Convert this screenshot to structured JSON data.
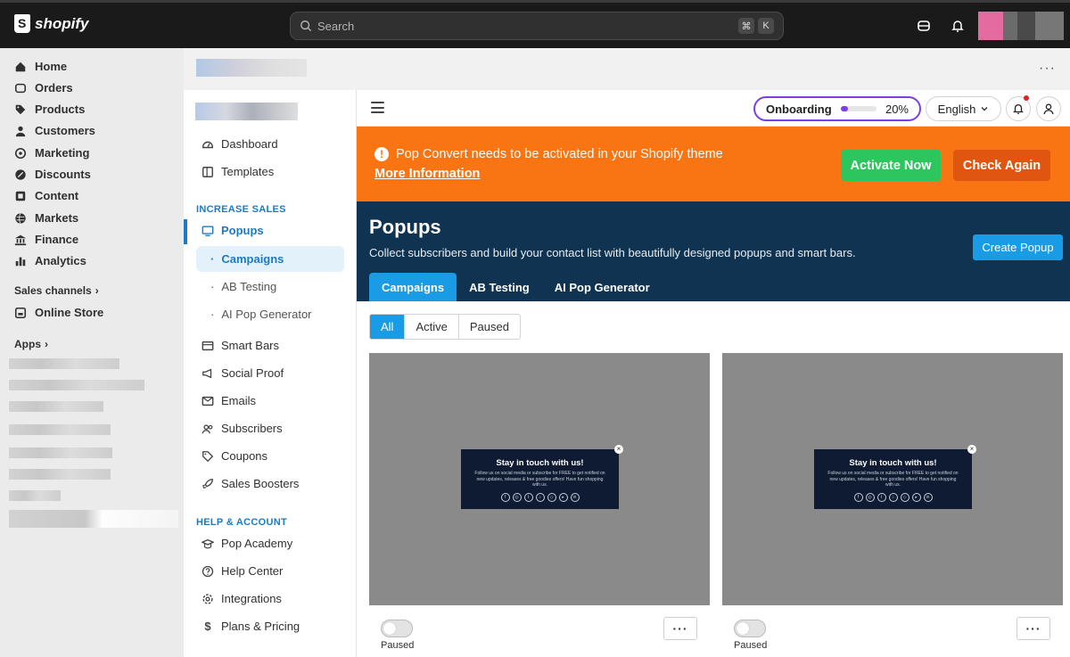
{
  "topbar": {
    "brand": "shopify",
    "search_placeholder": "Search",
    "shortcut": [
      "⌘",
      "K"
    ]
  },
  "sidebar": {
    "items": [
      {
        "label": "Home",
        "icon": "home-icon"
      },
      {
        "label": "Orders",
        "icon": "orders-icon"
      },
      {
        "label": "Products",
        "icon": "tag-icon"
      },
      {
        "label": "Customers",
        "icon": "person-icon"
      },
      {
        "label": "Marketing",
        "icon": "target-icon"
      },
      {
        "label": "Discounts",
        "icon": "discount-icon"
      },
      {
        "label": "Content",
        "icon": "content-icon"
      },
      {
        "label": "Markets",
        "icon": "globe-icon"
      },
      {
        "label": "Finance",
        "icon": "bank-icon"
      },
      {
        "label": "Analytics",
        "icon": "chart-icon"
      }
    ],
    "sales_channels_label": "Sales channels",
    "online_store": "Online Store",
    "apps_label": "Apps"
  },
  "app_nav": {
    "dashboard": "Dashboard",
    "templates": "Templates",
    "increase_sales": "INCREASE SALES",
    "popups": "Popups",
    "campaigns": "Campaigns",
    "ab_testing": "AB Testing",
    "ai_pop_generator": "AI Pop Generator",
    "smart_bars": "Smart Bars",
    "social_proof": "Social Proof",
    "emails": "Emails",
    "subscribers": "Subscribers",
    "coupons": "Coupons",
    "sales_boosters": "Sales Boosters",
    "help_account": "HELP & ACCOUNT",
    "pop_academy": "Pop Academy",
    "help_center": "Help Center",
    "integrations": "Integrations",
    "plans_pricing": "Plans & Pricing"
  },
  "app_header": {
    "onboarding_label": "Onboarding",
    "onboarding_progress": 0.2,
    "onboarding_pct": "20%",
    "language": "English"
  },
  "alert": {
    "message": "Pop Convert needs to be activated in your Shopify theme",
    "link": "More Information",
    "activate_label": "Activate Now",
    "check_label": "Check Again"
  },
  "hero": {
    "title": "Popups",
    "description": "Collect subscribers and build your contact list with beautifully designed popups and smart bars.",
    "create_label": "Create Popup",
    "tabs": [
      "Campaigns",
      "AB Testing",
      "AI Pop Generator"
    ]
  },
  "filters": [
    "All",
    "Active",
    "Paused"
  ],
  "cards": [
    {
      "popup_title": "Stay in touch with us!",
      "popup_text": "Follow us on social media or subscribe for FREE to get notified on new updates, releases & free goodies offers! Have fun shopping with us.",
      "status": "Paused"
    },
    {
      "popup_title": "Stay in touch with us!",
      "popup_text": "Follow us on social media or subscribe for FREE to get notified on new updates, releases & free goodies offers! Have fun shopping with us.",
      "status": "Paused"
    }
  ],
  "colors": {
    "accent": "#1a9be6",
    "alert": "#f97514",
    "hero": "#0f3350",
    "onboarding": "#7b3fe4"
  }
}
